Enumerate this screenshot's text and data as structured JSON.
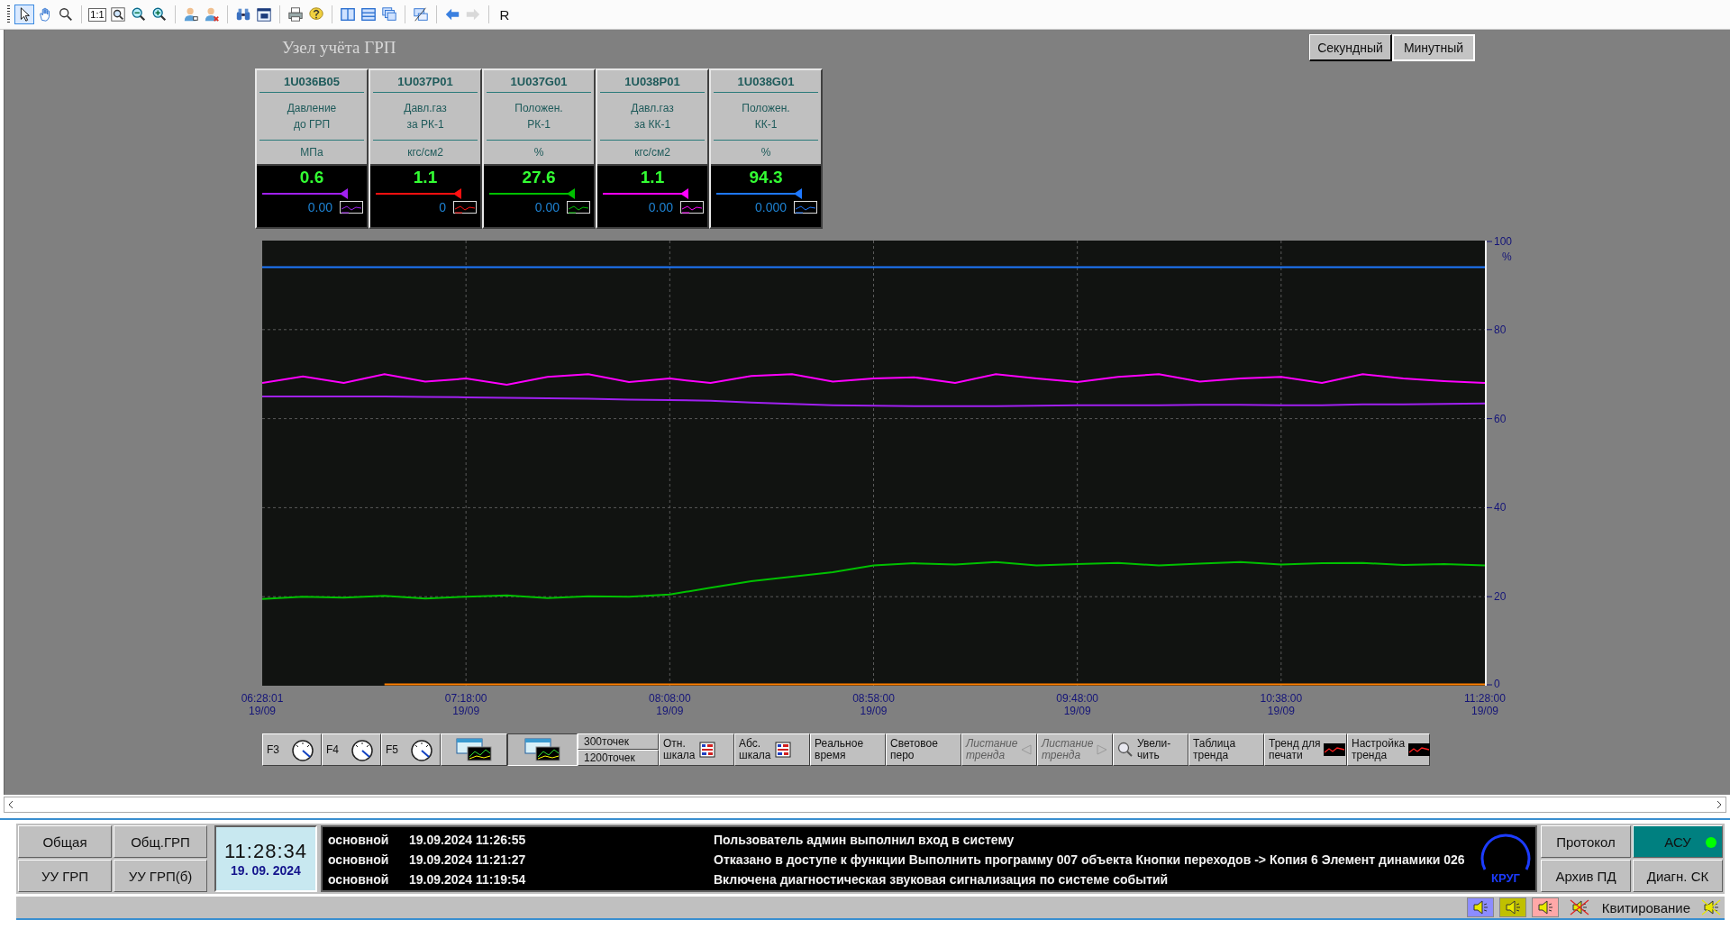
{
  "toolbar": [
    {
      "kind": "grip"
    },
    {
      "kind": "pointer",
      "selected": true,
      "disabled": false
    },
    {
      "kind": "hand",
      "selected": false,
      "disabled": false
    },
    {
      "kind": "search",
      "selected": false,
      "disabled": false
    },
    {
      "kind": "sep"
    },
    {
      "kind": "scale",
      "label": "1:1",
      "selected": false,
      "disabled": false
    },
    {
      "kind": "zoomfit",
      "selected": false,
      "disabled": false
    },
    {
      "kind": "zoomout",
      "selected": false,
      "disabled": false
    },
    {
      "kind": "zoomin",
      "selected": false,
      "disabled": false
    },
    {
      "kind": "sep"
    },
    {
      "kind": "user",
      "selected": false,
      "disabled": false
    },
    {
      "kind": "userdel",
      "selected": false,
      "disabled": false
    },
    {
      "kind": "sep"
    },
    {
      "kind": "binoculars",
      "selected": false,
      "disabled": false
    },
    {
      "kind": "doc",
      "selected": false,
      "disabled": false
    },
    {
      "kind": "sep"
    },
    {
      "kind": "print",
      "selected": false,
      "disabled": false
    },
    {
      "kind": "help",
      "selected": false,
      "disabled": false
    },
    {
      "kind": "sep"
    },
    {
      "kind": "cols",
      "selected": false,
      "disabled": false
    },
    {
      "kind": "rows",
      "selected": false,
      "disabled": false
    },
    {
      "kind": "windows",
      "selected": false,
      "disabled": false
    },
    {
      "kind": "sep"
    },
    {
      "kind": "screens",
      "selected": false,
      "disabled": false
    },
    {
      "kind": "sep"
    },
    {
      "kind": "back",
      "selected": false,
      "disabled": false
    },
    {
      "kind": "forward",
      "selected": false,
      "disabled": true
    },
    {
      "kind": "sep"
    },
    {
      "kind": "letter",
      "label": "R",
      "selected": false,
      "disabled": false
    }
  ],
  "title": "Узел учёта ГРП",
  "mode_tabs": [
    {
      "label": "Секундный",
      "selected": false
    },
    {
      "label": "Минутный",
      "selected": true
    }
  ],
  "tags": [
    {
      "tag": "1U036B05",
      "name_lines": [
        "Давление",
        "до ГРП"
      ],
      "unit": "МПа",
      "value": "0.6",
      "base": "0.00",
      "color": "#a020f0"
    },
    {
      "tag": "1U037P01",
      "name_lines": [
        "Давл.газ",
        "за РК-1"
      ],
      "unit": "кгс/см2",
      "value": "1.1",
      "base": "0",
      "color": "#ff1010"
    },
    {
      "tag": "1U037G01",
      "name_lines": [
        "Положен.",
        "РК-1"
      ],
      "unit": "%",
      "value": "27.6",
      "base": "0.00",
      "color": "#00c000"
    },
    {
      "tag": "1U038P01",
      "name_lines": [
        "Давл.газ",
        "за КК-1"
      ],
      "unit": "кгс/см2",
      "value": "1.1",
      "base": "0.00",
      "color": "#ff00ff"
    },
    {
      "tag": "1U038G01",
      "name_lines": [
        "Положен.",
        "КК-1"
      ],
      "unit": "%",
      "value": "94.3",
      "base": "0.000",
      "color": "#1e78ff"
    }
  ],
  "trend": {
    "chart_data": {
      "type": "line",
      "ylabel": "%",
      "categories": [
        "06:28:01 19/09",
        null,
        null,
        null,
        null,
        "07:18:00 19/09",
        null,
        null,
        null,
        null,
        "08:08:00 19/09",
        null,
        null,
        null,
        null,
        "08:58:00 19/09",
        null,
        null,
        null,
        null,
        "09:48:00 19/09",
        null,
        null,
        null,
        null,
        "10:38:00 19/09",
        null,
        null,
        null,
        null,
        "11:28:00 19/09"
      ],
      "ylim": [
        0,
        100
      ],
      "grid": true,
      "yticks": [
        0,
        20,
        40,
        60,
        80,
        100
      ],
      "series": [
        {
          "color": "#1e78ff",
          "values": [
            94,
            94,
            94,
            94,
            94,
            94,
            94,
            94,
            94,
            94,
            94,
            94,
            94,
            94,
            94,
            94,
            94,
            94,
            94,
            94,
            94,
            94,
            94,
            94,
            94,
            94,
            94,
            94,
            94,
            94,
            94
          ]
        },
        {
          "color": "#ff00ff",
          "values": [
            68,
            69.5,
            68,
            70,
            68.3,
            69,
            67.6,
            69.4,
            70,
            68.2,
            69,
            68,
            69.6,
            70,
            68.3,
            69,
            69.3,
            68,
            70,
            69,
            68.2,
            69.4,
            70,
            68.3,
            69,
            69.4,
            68,
            70,
            69,
            68.4,
            68
          ]
        },
        {
          "color": "#a020f0",
          "values": [
            65,
            65,
            65,
            65,
            64.9,
            64.8,
            64.7,
            64.6,
            64.5,
            64.3,
            64.2,
            64,
            63.6,
            63.3,
            63,
            62.9,
            62.8,
            62.8,
            62.8,
            62.9,
            63,
            63,
            63,
            63.1,
            63.1,
            63,
            63,
            63.2,
            63.2,
            63.3,
            63.4
          ]
        },
        {
          "color": "#00c000",
          "values": [
            19.5,
            20,
            19.8,
            20.2,
            19.6,
            20,
            20.3,
            19.7,
            20.1,
            20,
            20.5,
            22,
            23.5,
            24.5,
            25.5,
            27,
            27.5,
            27.2,
            27.8,
            27,
            27.3,
            27.6,
            27,
            27.4,
            27.8,
            27.2,
            27.5,
            27.6,
            27.1,
            27.3,
            27
          ]
        },
        {
          "color": "#ff8000",
          "values": [
            null,
            null,
            null,
            0.3,
            0.3,
            0.3,
            0.3,
            0.3,
            0.3,
            0.3,
            0.3,
            0.3,
            0.3,
            0.3,
            0.3,
            0.3,
            0.3,
            0.3,
            0.3,
            0.3,
            0.3,
            0.3,
            0.3,
            0.3,
            0.3,
            0.3,
            0.3,
            0.3,
            0.3,
            0.3,
            0.3
          ]
        }
      ]
    }
  },
  "trend_buttons": [
    {
      "kind": "key",
      "label": "F3"
    },
    {
      "kind": "key",
      "label": "F4"
    },
    {
      "kind": "key",
      "label": "F5"
    },
    {
      "kind": "icon",
      "pressed": false
    },
    {
      "kind": "icon",
      "pressed": true
    },
    {
      "kind": "points",
      "options": [
        "300точек",
        "1200точек"
      ]
    },
    {
      "kind": "scale",
      "lines": [
        "Отн.",
        "шкала"
      ],
      "disabled": false
    },
    {
      "kind": "scale",
      "lines": [
        "Абс.",
        "шкала"
      ],
      "disabled": false
    },
    {
      "kind": "plain",
      "lines": [
        "Реальное",
        "время"
      ],
      "disabled": false
    },
    {
      "kind": "plain",
      "lines": [
        "Световое",
        "перо"
      ],
      "disabled": false
    },
    {
      "kind": "pageback",
      "lines": [
        "Листание",
        "тренда"
      ],
      "disabled": true
    },
    {
      "kind": "pageforward",
      "lines": [
        "Листание",
        "тренда"
      ],
      "disabled": true
    },
    {
      "kind": "zoom",
      "lines": [
        "Увели-",
        "чить"
      ],
      "disabled": false
    },
    {
      "kind": "plain",
      "lines": [
        "Таблица",
        "тренда"
      ],
      "disabled": false
    },
    {
      "kind": "trendicon",
      "lines": [
        "Тренд для",
        "печати"
      ],
      "disabled": false
    },
    {
      "kind": "trendicon",
      "lines": [
        "Настройка",
        "тренда"
      ],
      "disabled": false
    }
  ],
  "nav_buttons": [
    "Общая",
    "Общ.ГРП",
    "УУ ГРП",
    "УУ ГРП(б)"
  ],
  "clock": {
    "time": "11:28:34",
    "date": "19. 09. 2024"
  },
  "events": [
    {
      "source": "основной",
      "time": "19.09.2024 11:26:55",
      "message": "Пользователь админ выполнил вход в систему"
    },
    {
      "source": "основной",
      "time": "19.09.2024 11:21:27",
      "message": "Отказано в доступе к функции Выполнить программу 007 объекта Кнопки переходов -> Копия 6 Элемент динамики 026"
    },
    {
      "source": "основной",
      "time": "19.09.2024 11:19:54",
      "message": "Включена диагностическая звуковая сигнализация по системе событий"
    }
  ],
  "logo": "КРУГ",
  "side_buttons": [
    {
      "label": "Протокол",
      "active": false
    },
    {
      "label": "АСУ",
      "active": true
    },
    {
      "label": "Архив ПД",
      "active": false
    },
    {
      "label": "Диагн. СК",
      "active": false
    }
  ],
  "sound_buttons": [
    {
      "color": "#8c8cff"
    },
    {
      "color": "#c0c000"
    },
    {
      "color": "#ffa8a8"
    }
  ],
  "ack": "Квитирование"
}
